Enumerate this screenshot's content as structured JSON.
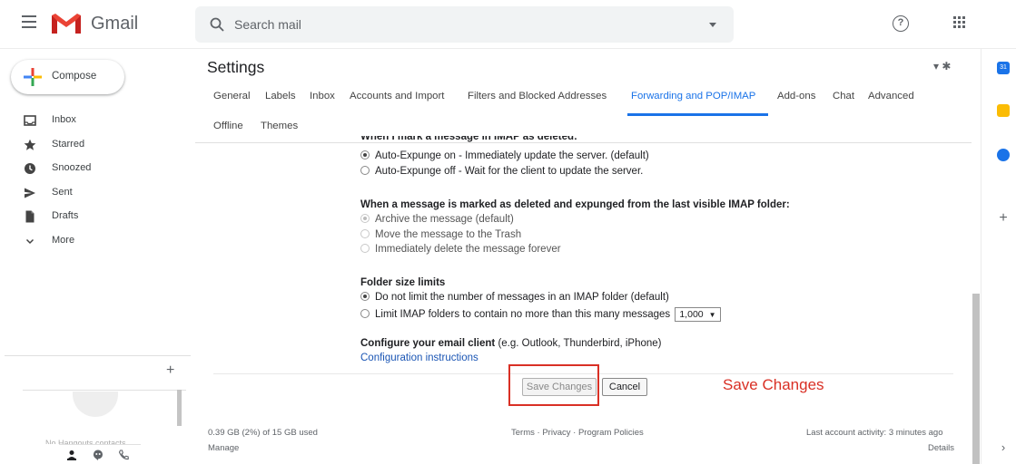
{
  "header": {
    "app_name": "Gmail",
    "search_placeholder": "Search mail"
  },
  "compose_label": "Compose",
  "nav": [
    {
      "label": "Inbox",
      "icon": "inbox-icon"
    },
    {
      "label": "Starred",
      "icon": "star-icon"
    },
    {
      "label": "Snoozed",
      "icon": "clock-icon"
    },
    {
      "label": "Sent",
      "icon": "send-icon"
    },
    {
      "label": "Drafts",
      "icon": "file-icon"
    },
    {
      "label": "More",
      "icon": "chevron-down-icon"
    }
  ],
  "hangouts": {
    "empty_text": "No Hangouts contacts"
  },
  "settings": {
    "title": "Settings",
    "tabs_row1": [
      "General",
      "Labels",
      "Inbox",
      "Accounts and Import",
      "Filters and Blocked Addresses",
      "Forwarding and POP/IMAP",
      "Add-ons",
      "Chat",
      "Advanced"
    ],
    "tabs_row2": [
      "Offline",
      "Themes"
    ],
    "active_tab": "Forwarding and POP/IMAP"
  },
  "imap": {
    "cut_heading": "When I mark a message in IMAP as deleted:",
    "expunge_on": "Auto-Expunge on - Immediately update the server. (default)",
    "expunge_off": "Auto-Expunge off - Wait for the client to update the server.",
    "expunged_heading": "When a message is marked as deleted and expunged from the last visible IMAP folder:",
    "archive": "Archive the message (default)",
    "trash": "Move the message to the Trash",
    "delete_forever": "Immediately delete the message forever",
    "folder_heading": "Folder size limits",
    "no_limit": "Do not limit the number of messages in an IMAP folder (default)",
    "limit": "Limit IMAP folders to contain no more than this many messages",
    "limit_value": "1,000",
    "client_heading": "Configure your email client",
    "client_examples": " (e.g. Outlook, Thunderbird, iPhone)",
    "config_link": "Configuration instructions"
  },
  "buttons": {
    "save": "Save Changes",
    "cancel": "Cancel"
  },
  "annotation": "Save Changes",
  "footer": {
    "storage": "0.39 GB (2%) of 15 GB used",
    "manage": "Manage",
    "terms": "Terms",
    "privacy": "Privacy",
    "policies": "Program Policies",
    "last_activity": "Last account activity: 3 minutes ago",
    "details": "Details"
  }
}
